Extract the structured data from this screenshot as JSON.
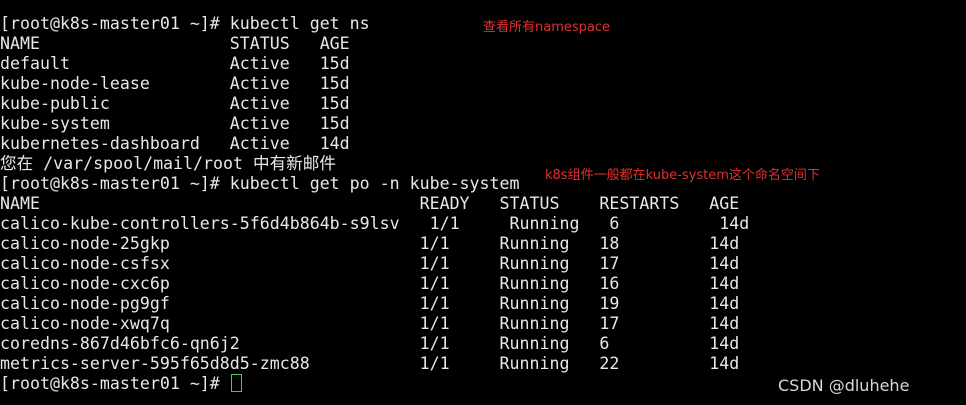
{
  "terminal": {
    "lines": [
      "[root@k8s-master01 ~]# kubectl get ns",
      "NAME                   STATUS   AGE",
      "default                Active   15d",
      "kube-node-lease        Active   15d",
      "kube-public            Active   15d",
      "kube-system            Active   15d",
      "kubernetes-dashboard   Active   14d",
      "您在 /var/spool/mail/root 中有新邮件",
      "[root@k8s-master01 ~]# kubectl get po -n kube-system",
      "NAME                                      READY   STATUS    RESTARTS   AGE",
      "calico-kube-controllers-5f6d4b864b-s9lsv   1/1     Running   6          14d",
      "calico-node-25gkp                         1/1     Running   18         14d",
      "calico-node-csfsx                         1/1     Running   17         14d",
      "calico-node-cxc6p                         1/1     Running   16         14d",
      "calico-node-pg9gf                         1/1     Running   19         14d",
      "calico-node-xwq7q                         1/1     Running   17         14d",
      "coredns-867d46bfc6-qn6j2                  1/1     Running   6          14d",
      "metrics-server-595f65d8d5-zmc88           1/1     Running   22         14d"
    ],
    "prompt": "[root@k8s-master01 ~]# "
  },
  "annotations": {
    "namespace_note": "查看所有namespace",
    "kube_system_note": "k8s组件一般都在kube-system这个命名空间下"
  },
  "watermark": "CSDN @dluhehe",
  "colors": {
    "background": "#000000",
    "text": "#e8e8e8",
    "annotation": "#e03030",
    "cursor": "#3fd23f"
  }
}
